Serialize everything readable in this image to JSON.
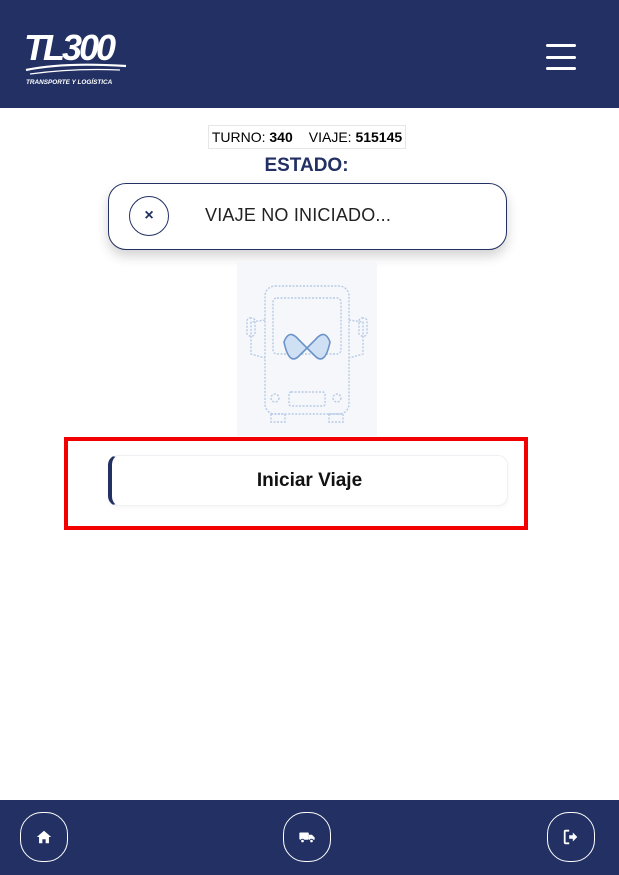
{
  "header": {
    "logo_text": "TL300",
    "logo_tagline": "TRANSPORTE Y LOGÍSTICA",
    "menu_icon": "hamburger-menu-icon"
  },
  "trip_info": {
    "turno_label": "TURNO:",
    "turno_value": "340",
    "viaje_label": "VIAJE:",
    "viaje_value": "515145"
  },
  "status": {
    "title": "ESTADO:",
    "icon": "close-icon",
    "icon_glyph": "×",
    "text": "VIAJE NO INICIADO..."
  },
  "main": {
    "start_button_label": "Iniciar Viaje"
  },
  "bottom_nav": {
    "items": [
      {
        "icon": "home-icon"
      },
      {
        "icon": "truck-icon"
      },
      {
        "icon": "logout-icon"
      }
    ]
  },
  "colors": {
    "brand": "#223063",
    "highlight": "#f20000"
  }
}
